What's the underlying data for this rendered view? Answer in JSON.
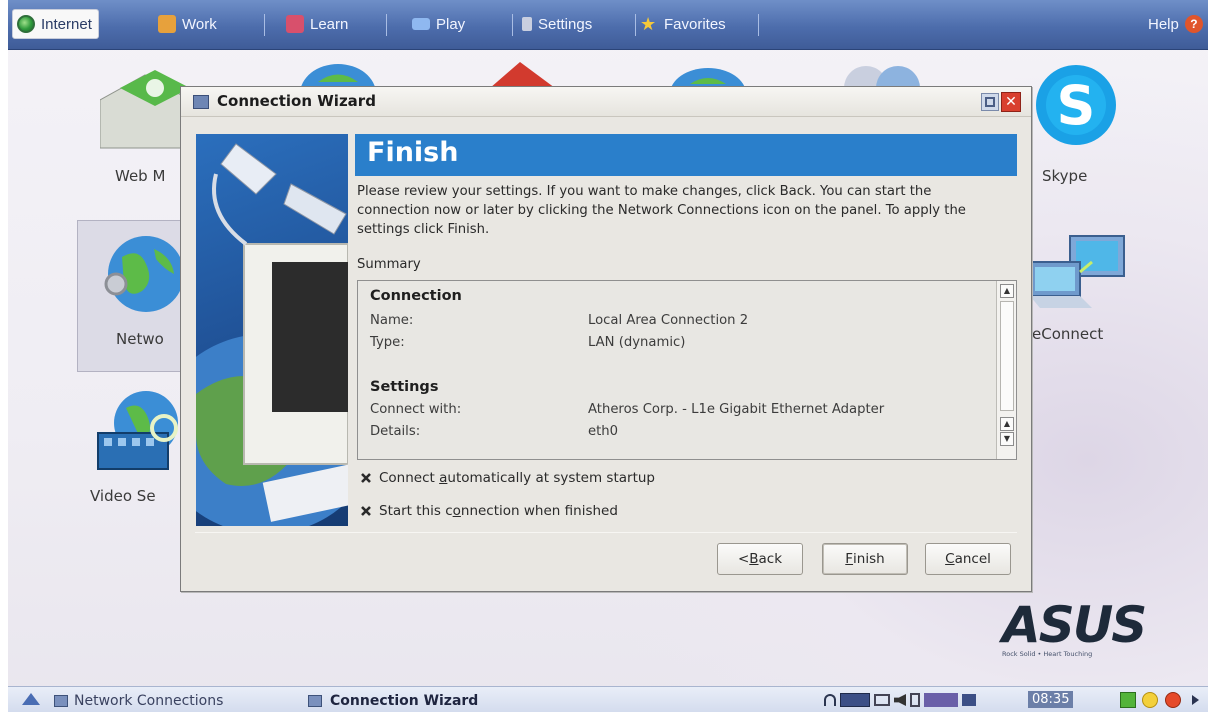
{
  "topbar": {
    "tabs": [
      {
        "label": "Internet",
        "icon": "globe-icon",
        "active": true
      },
      {
        "label": "Work",
        "icon": "briefcase-icon"
      },
      {
        "label": "Learn",
        "icon": "book-icon"
      },
      {
        "label": "Play",
        "icon": "gamepad-icon"
      },
      {
        "label": "Settings",
        "icon": "wrench-icon"
      },
      {
        "label": "Favorites",
        "icon": "star-icon"
      }
    ],
    "help_label": "Help"
  },
  "desktop": {
    "icons": [
      {
        "label": "Web M",
        "icon": "web-mail-icon"
      },
      {
        "label": "Netwo",
        "icon": "network-icon"
      },
      {
        "label": "Video Se",
        "icon": "video-search-icon"
      },
      {
        "label": "Skype",
        "icon": "skype-icon"
      },
      {
        "label": "eConnect",
        "icon": "econnect-icon"
      }
    ],
    "brand": {
      "logo": "ASUS",
      "tagline": "Rock Solid • Heart Touching"
    }
  },
  "dialog": {
    "title": "Connection Wizard",
    "banner": "Finish",
    "intro": "Please review your settings. If you want to make changes, click Back. You can start the connection now or later by clicking the Network Connections icon on the panel. To apply the settings click Finish.",
    "summary_label": "Summary",
    "summary": {
      "connection_heading": "Connection",
      "name_key": "Name:",
      "name_value": "Local Area Connection 2",
      "type_key": "Type:",
      "type_value": "LAN (dynamic)",
      "settings_heading": "Settings",
      "connect_with_key": "Connect with:",
      "connect_with_value": "Atheros Corp. - L1e Gigabit Ethernet Adapter",
      "details_key": "Details:",
      "details_value": "eth0"
    },
    "options": {
      "auto_connect": {
        "label_pre": "Connect ",
        "label_mnemonic": "a",
        "label_post": "utomatically at system startup",
        "checked": true
      },
      "start_when_finished": {
        "label_pre": "Start this c",
        "label_mnemonic": "o",
        "label_post": "nnection when finished",
        "checked": true
      }
    },
    "buttons": {
      "back": {
        "pre": "< ",
        "mnemonic": "B",
        "post": "ack"
      },
      "finish": {
        "mnemonic": "F",
        "post": "inish"
      },
      "cancel": {
        "mnemonic": "C",
        "post": "ancel"
      }
    }
  },
  "taskbar": {
    "items": [
      {
        "label": "Network Connections",
        "active": false
      },
      {
        "label": "Connection Wizard",
        "active": true
      }
    ],
    "clock": "08:35"
  },
  "colors": {
    "topbar": "#4d6dac",
    "banner": "#2a7fcb",
    "dialog_bg": "#e9e7e2"
  }
}
